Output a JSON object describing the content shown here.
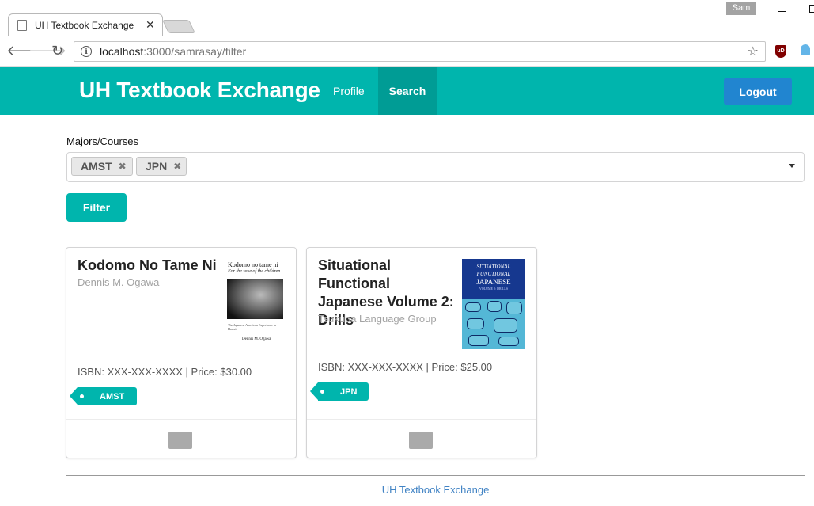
{
  "browser": {
    "tab_title": "UH Textbook Exchange",
    "tab_close": "✕",
    "profile_name": "Sam",
    "url_host": "localhost",
    "url_path": ":3000/samrasay/filter",
    "extension_badge": "uD"
  },
  "nav": {
    "brand": "UH Textbook Exchange",
    "items": [
      {
        "label": "Profile",
        "active": false
      },
      {
        "label": "Search",
        "active": true
      }
    ],
    "logout_label": "Logout"
  },
  "filter": {
    "label": "Majors/Courses",
    "selected": [
      "AMST",
      "JPN"
    ],
    "remove_glyph": "✖",
    "button_label": "Filter"
  },
  "books": [
    {
      "title": "Kodomo No Tame Ni",
      "author": "Dennis M. Ogawa",
      "meta": "ISBN: XXX-XXX-XXXX | Price: $30.00",
      "tag": "AMST",
      "cover": {
        "title": "Kodomo no tame ni",
        "subtitle": "For the sake of the children",
        "line": "The Japanese American Experience in Hawaii",
        "author": "Dennis M. Ogawa"
      }
    },
    {
      "title": "Situational Functional Japanese Volume 2: Drills",
      "author": "Tsukuba Language Group",
      "meta": "ISBN: XXX-XXX-XXXX | Price: $25.00",
      "tag": "JPN",
      "cover": {
        "line1": "SITUATIONAL",
        "line2": "FUNCTIONAL",
        "line3": "JAPANESE",
        "line4": "VOLUME 2: DRILLS"
      }
    }
  ],
  "footer": {
    "label": "UH Textbook Exchange"
  },
  "colors": {
    "teal": "#00b5ad",
    "teal_active": "#009c95",
    "blue": "#2185d0",
    "link": "#4183c4"
  },
  "icons": [
    "page-icon",
    "back-arrow-icon",
    "forward-arrow-icon",
    "reload-icon",
    "info-icon",
    "star-icon",
    "envelope-icon",
    "dropdown-caret-icon"
  ]
}
